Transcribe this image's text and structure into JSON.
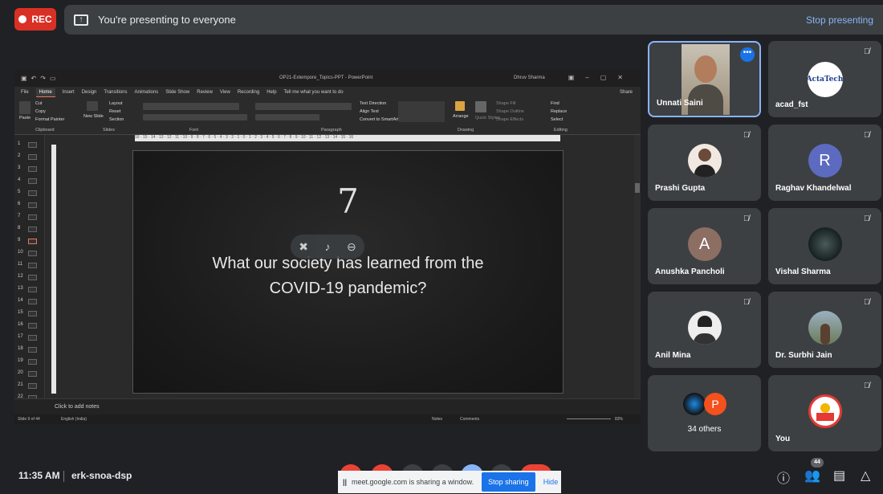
{
  "topbar": {
    "rec_label": "REC",
    "presenting_text": "You're presenting to everyone",
    "stop_presenting": "Stop presenting"
  },
  "powerpoint": {
    "window_title": "OP21-Extempore_Topics-PPT  -  PowerPoint",
    "user": "Dhruv Sharma",
    "tabs": [
      "File",
      "Home",
      "Insert",
      "Design",
      "Transitions",
      "Animations",
      "Slide Show",
      "Review",
      "View",
      "Recording",
      "Help",
      "Tell me what you want to do"
    ],
    "share": "Share",
    "ribbon": {
      "paste": "Paste",
      "cut": "Cut",
      "copy": "Copy",
      "format_painter": "Format Painter",
      "clipboard": "Clipboard",
      "new_slide": "New Slide",
      "layout": "Layout",
      "reset": "Reset",
      "section": "Section",
      "slides": "Slides",
      "font": "Font",
      "paragraph": "Paragraph",
      "text_direction": "Text Direction",
      "align_text": "Align Text",
      "convert_smartart": "Convert to SmartArt",
      "arrange": "Arrange",
      "quick_styles": "Quick Styles",
      "shape_fill": "Shape Fill",
      "shape_outline": "Shape Outline",
      "shape_effects": "Shape Effects",
      "drawing": "Drawing",
      "find": "Find",
      "replace": "Replace",
      "select": "Select",
      "editing": "Editing"
    },
    "slide_numbers": [
      "1",
      "2",
      "3",
      "4",
      "5",
      "6",
      "7",
      "8",
      "9",
      "10",
      "11",
      "12",
      "13",
      "14",
      "15",
      "16",
      "17",
      "18",
      "19",
      "20",
      "21",
      "22"
    ],
    "ruler_text": "16 · 15 · 14 · 13 · 12 · 11 · 10 · 9 · 8 · 7 · 6 · 5 · 4 · 3 · 2 · 1 · 0 · 1 · 2 · 3 · 4 · 5 · 6 · 7 · 8 · 9 · 10 · 11 · 12 · 13 · 14 · 15 · 16",
    "slide": {
      "number": "7",
      "question_line1": "What our society has learned from the",
      "question_line2": "COVID-19 pandemic?"
    },
    "notes_placeholder": "Click to add notes",
    "status": {
      "slide_of": "Slide 9 of 44",
      "language": "English (India)",
      "notes": "Notes",
      "comments": "Comments",
      "zoom": "83%"
    }
  },
  "participants": [
    {
      "name": "Unnati Saini",
      "muted": false,
      "active": true
    },
    {
      "name": "acad_fst",
      "muted": true,
      "logo_text": "ActaTech"
    },
    {
      "name": "Prashi Gupta",
      "muted": true
    },
    {
      "name": "Raghav Khandelwal",
      "muted": true,
      "initial": "R",
      "color": "#5c6bc0"
    },
    {
      "name": "Anushka Pancholi",
      "muted": true,
      "initial": "A",
      "color": "#8d6e63"
    },
    {
      "name": "Vishal Sharma",
      "muted": true
    },
    {
      "name": "Anil Mina",
      "muted": true
    },
    {
      "name": "Dr. Surbhi Jain",
      "muted": true
    },
    {
      "name": "34 others",
      "initial": "P",
      "color": "#f4511e"
    },
    {
      "name": "You",
      "muted": true
    }
  ],
  "bottombar": {
    "time": "11:35 AM",
    "meeting_code": "erk-snoa-dsp",
    "sharing_banner": "meet.google.com is sharing a window.",
    "stop_sharing": "Stop sharing",
    "hide": "Hide",
    "participant_count": "44"
  },
  "colors": {
    "rec": "#d93025",
    "accent": "#8ab4f8",
    "tile": "#3c4043",
    "background": "#202124"
  }
}
